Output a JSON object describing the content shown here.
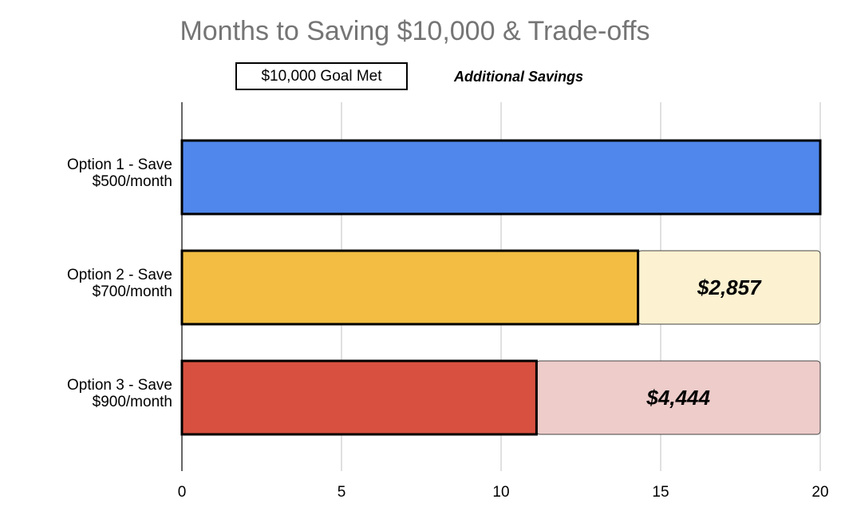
{
  "chart_data": {
    "type": "bar",
    "orientation": "horizontal",
    "stacked": true,
    "title": "Months to Saving $10,000 & Trade-offs",
    "categories": [
      [
        "Option 1 - Save",
        "$500/month"
      ],
      [
        "Option 2 - Save",
        "$700/month"
      ],
      [
        "Option 3 - Save",
        "$900/month"
      ]
    ],
    "series": [
      {
        "name": "$10,000 Goal Met",
        "values": [
          20,
          14.29,
          11.11
        ],
        "colors": [
          "#5087EC",
          "#F2BD42",
          "#D85140"
        ]
      },
      {
        "name": "Additional Savings",
        "values": [
          0,
          5.71,
          8.89
        ],
        "colors": [
          "#DCE7FB",
          "#FCF1D1",
          "#EDCCCA"
        ],
        "data_labels": [
          "",
          "$2,857",
          "$4,444"
        ]
      }
    ],
    "xlim": [
      0,
      20
    ],
    "xticks": [
      "0",
      "5",
      "10",
      "15",
      "20"
    ],
    "grid": true,
    "legend_position": "top"
  }
}
